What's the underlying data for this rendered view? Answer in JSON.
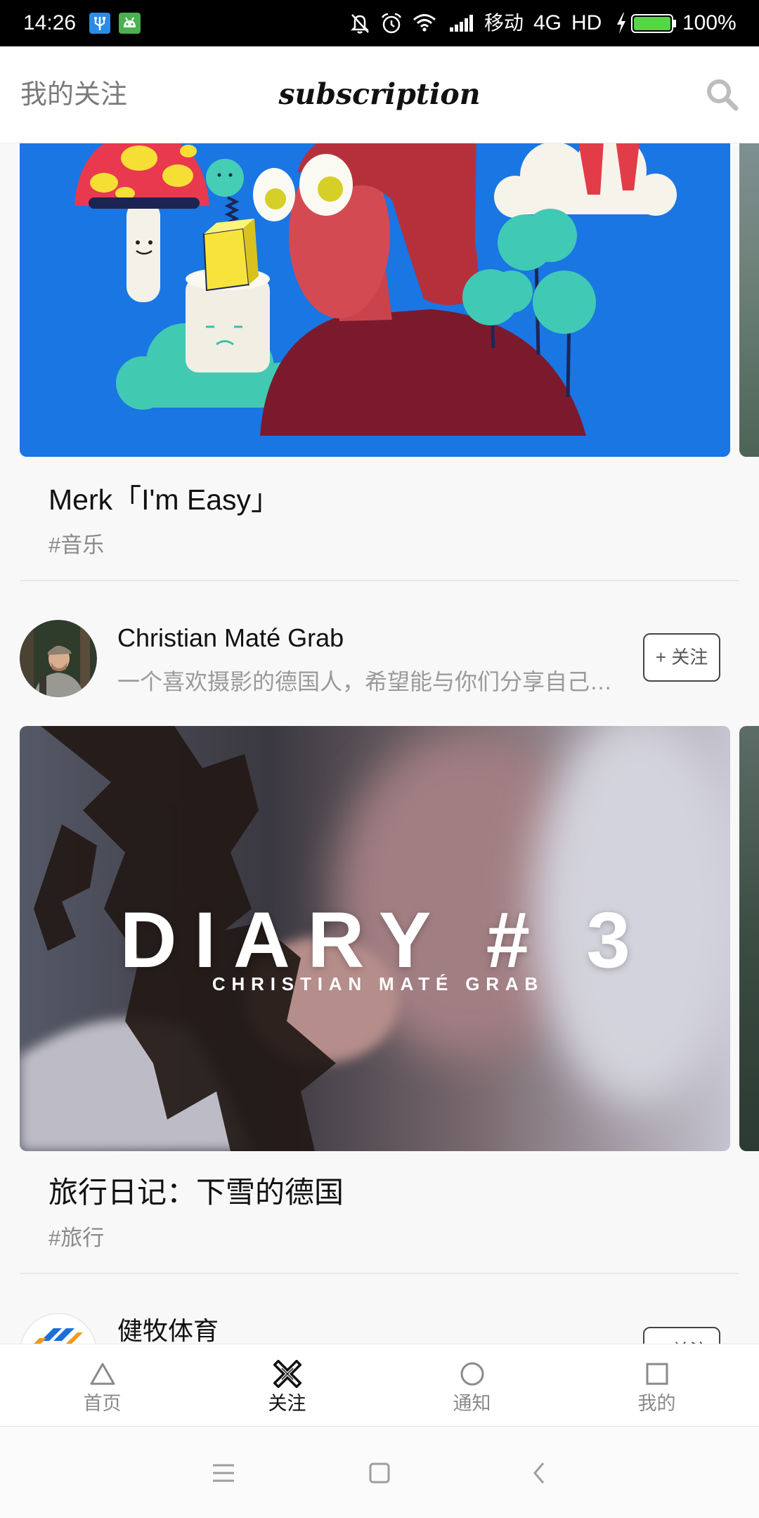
{
  "status_bar": {
    "time": "14:26",
    "carrier": "移动",
    "network": "4G",
    "hd": "HD",
    "battery": "100%",
    "battery_level": 1.0,
    "icons": [
      "usb-icon",
      "debug-icon",
      "mute-icon",
      "alarm-icon",
      "wifi-icon",
      "signal-icon",
      "charging-icon",
      "battery-icon"
    ]
  },
  "header": {
    "left_label": "我的关注",
    "title": "subscription",
    "search_icon": "search-icon"
  },
  "feed": {
    "posts": [
      {
        "title": "Merk「I'm Easy」",
        "tag": "#音乐"
      },
      {
        "title": "旅行日记：下雪的德国",
        "tag": "#旅行",
        "overlay_title": "DIARY # 3",
        "overlay_subtitle": "CHRISTIAN MATÉ GRAB"
      }
    ],
    "authors": [
      {
        "name": "Christian Maté Grab",
        "description": "一个喜欢摄影的德国人，希望能与你们分享自己…",
        "follow_label": "+ 关注"
      },
      {
        "name": "健牧体育",
        "follow_label": "+ 关注"
      }
    ]
  },
  "bottom_nav": {
    "tabs": [
      {
        "label": "首页",
        "icon": "triangle-icon",
        "active": false
      },
      {
        "label": "关注",
        "icon": "cross-icon",
        "active": true
      },
      {
        "label": "通知",
        "icon": "circle-icon",
        "active": false
      },
      {
        "label": "我的",
        "icon": "square-icon",
        "active": false
      }
    ]
  },
  "system_nav": {
    "icons": [
      "menu-icon",
      "home-icon",
      "back-icon"
    ]
  },
  "colors": {
    "status_bar": "#000000",
    "background": "#f8f8f8",
    "active_tab": "#111111",
    "inactive_tab": "#8a8a8a",
    "battery_fill": "#55d646"
  }
}
